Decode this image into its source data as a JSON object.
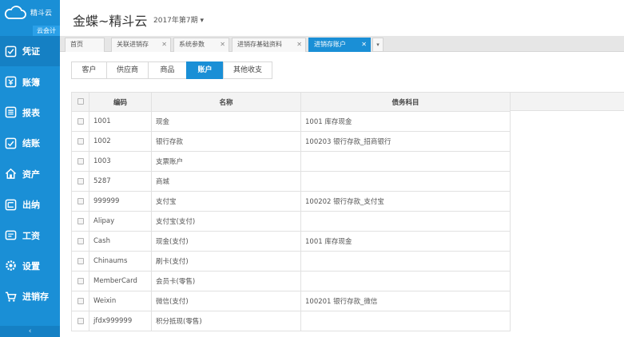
{
  "sidebar": {
    "logo_text": "精斗云",
    "logo_badge": "云会计",
    "items": [
      {
        "label": "凭证",
        "icon": "voucher-icon"
      },
      {
        "label": "账簿",
        "icon": "ledger-icon"
      },
      {
        "label": "报表",
        "icon": "report-icon"
      },
      {
        "label": "结账",
        "icon": "checkout-icon"
      },
      {
        "label": "资产",
        "icon": "asset-icon"
      },
      {
        "label": "出纳",
        "icon": "cashier-icon"
      },
      {
        "label": "工资",
        "icon": "salary-icon"
      },
      {
        "label": "设置",
        "icon": "gear-icon"
      },
      {
        "label": "进销存",
        "icon": "cart-icon"
      }
    ],
    "collapse_label": "‹"
  },
  "header": {
    "brand": "金蝶~精斗云",
    "period": "2017年第7期 ▾"
  },
  "tabs": [
    {
      "label": "首页",
      "closable": false
    },
    {
      "label": "关联进销存",
      "closable": true
    },
    {
      "label": "系统参数",
      "closable": true
    },
    {
      "label": "进销存基础资料",
      "closable": true
    },
    {
      "label": "进销存账户",
      "closable": true,
      "active": true
    }
  ],
  "tab_more": "▾",
  "subtabs": [
    {
      "label": "客户"
    },
    {
      "label": "供应商"
    },
    {
      "label": "商品"
    },
    {
      "label": "账户",
      "active": true
    },
    {
      "label": "其他收支"
    }
  ],
  "table": {
    "headers": {
      "code": "编码",
      "name": "名称",
      "account": "债务科目"
    },
    "rows": [
      {
        "code": "1001",
        "name": "现金",
        "account": "1001 库存现金"
      },
      {
        "code": "1002",
        "name": "银行存款",
        "account": "100203 银行存款_招商银行"
      },
      {
        "code": "1003",
        "name": "支票账户",
        "account": ""
      },
      {
        "code": "5287",
        "name": "商城",
        "account": ""
      },
      {
        "code": "999999",
        "name": "支付宝",
        "account": "100202 银行存款_支付宝"
      },
      {
        "code": "Alipay",
        "name": "支付宝(支付)",
        "account": ""
      },
      {
        "code": "Cash",
        "name": "现金(支付)",
        "account": "1001 库存现金"
      },
      {
        "code": "Chinaums",
        "name": "刷卡(支付)",
        "account": ""
      },
      {
        "code": "MemberCard",
        "name": "会员卡(零售)",
        "account": ""
      },
      {
        "code": "Weixin",
        "name": "微信(支付)",
        "account": "100201 银行存款_微信"
      },
      {
        "code": "jfdx999999",
        "name": "积分抵现(零售)",
        "account": ""
      }
    ]
  },
  "colors": {
    "accent": "#1a8fd6",
    "sidebar": "#1a8fd6"
  }
}
